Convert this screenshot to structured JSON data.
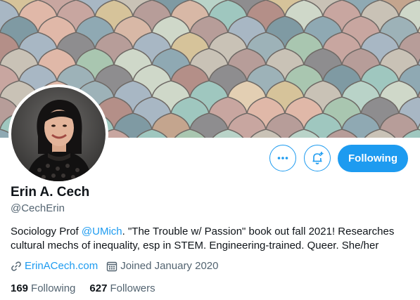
{
  "profile": {
    "name": "Erin A. Cech",
    "handle": "@CechErin",
    "bio_prefix": "Sociology Prof ",
    "bio_mention": "@UMich",
    "bio_suffix": ". \"The Trouble w/ Passion\" book out fall 2021! Researches cultural mechs of inequality, esp in STEM. Engineering-trained. Queer. She/her",
    "website": "ErinACech.com",
    "joined": "Joined January 2020",
    "following_count": "169",
    "following_label": "Following",
    "followers_count": "627",
    "followers_label": "Followers"
  },
  "actions": {
    "more_icon": "more-dots-icon",
    "notify_icon": "bell-plus-icon",
    "following_button": "Following"
  },
  "colors": {
    "accent": "#1d9bf0",
    "secondary_text": "#536471",
    "primary_text": "#0f1419"
  }
}
